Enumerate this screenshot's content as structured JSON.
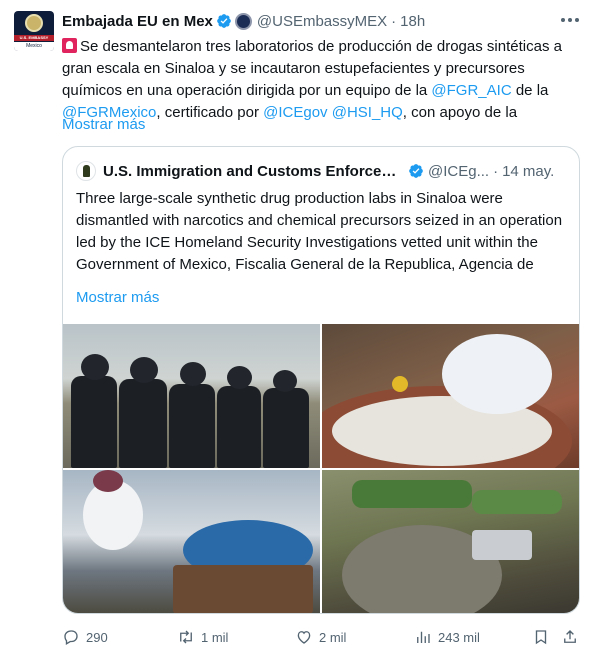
{
  "tweet": {
    "author_name": "Embajada EU en Mex",
    "handle": "@USEmbassyMEX",
    "separator": "·",
    "time": "18h",
    "avatar_text": {
      "band": "U.S. EMBASSY",
      "city": "Mexico"
    },
    "text": {
      "part1": "Se desmantelaron tres laboratorios de producción de drogas sintéticas a gran escala en Sinaloa y se incautaron estupefacientes y precursores químicos en una operación dirigida por un equipo de la ",
      "mention1": "@FGR_AIC",
      "part2": " de la ",
      "mention2": "@FGRMexico",
      "part3": ", certificado por ",
      "mention3": "@ICEgov",
      "part4": " ",
      "mention4": "@HSI_HQ",
      "part5": ", con apoyo de la"
    },
    "show_more": "Mostrar más"
  },
  "quote": {
    "author_name": "U.S. Immigration and Customs Enforceme...",
    "handle": "@ICEg...",
    "separator": "·",
    "time": "14 may.",
    "text": "Three large-scale synthetic drug production labs in Sinaloa were dismantled with narcotics and chemical precursors seized in an operation led by the ICE Homeland Security Investigations vetted unit within the Government of Mexico, Fiscalia General de la Republica, Agencia de",
    "show_more": "Mostrar más"
  },
  "actions": {
    "reply_count": "290",
    "retweet_count": "1 mil",
    "like_count": "2 mil",
    "views_count": "243 mil"
  },
  "colors": {
    "accent": "#1d9bf0",
    "text_primary": "#0f1419",
    "text_secondary": "#536471",
    "border": "#cfd9de",
    "verified": "#1d9bf0"
  },
  "icons": [
    "more-icon",
    "verified-badge-icon",
    "government-badge-icon",
    "siren-emoji-icon",
    "reply-icon",
    "retweet-icon",
    "like-icon",
    "views-icon",
    "bookmark-icon",
    "share-icon"
  ]
}
